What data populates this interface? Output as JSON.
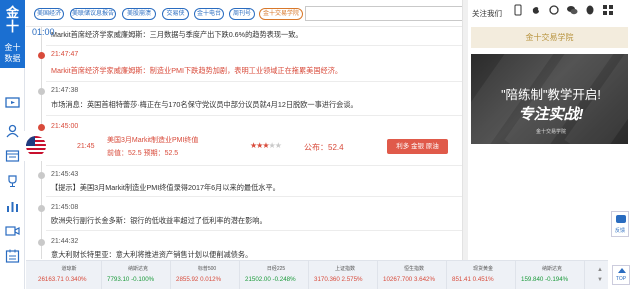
{
  "sidebar": {
    "logo_line1": "金十",
    "logo_line2": "金十",
    "logo_line3": "数据"
  },
  "tags": [
    {
      "label": "美国经济",
      "active": false
    },
    {
      "label": "美联储议息报告",
      "active": false
    },
    {
      "label": "美股崩溃",
      "active": false
    },
    {
      "label": "交易侠",
      "active": false
    },
    {
      "label": "金十电台",
      "active": false
    },
    {
      "label": "周刊号",
      "active": false
    },
    {
      "label": "金十交易学院",
      "active": true
    }
  ],
  "overlay_text": "01:00",
  "feed": [
    {
      "time": "",
      "text": "Markit首席经济学家威廉姆斯：三月数据与季度产出下跌0.6%的趋势表现一致。",
      "highlight": false
    },
    {
      "time": "21:47:47",
      "text": "Markit首席经济学家威廉姆斯：制造业PMI下跌趋势加剧，表明工业领域正在拖累美国经济。",
      "highlight": true
    },
    {
      "time": "21:47:38",
      "text": "市场消息：英国首相特蕾莎·梅正在与170名保守党议员中部分议员就4月12日脱欧一事进行会谈。",
      "highlight": false
    },
    {
      "time": "21:45:00",
      "text": "",
      "highlight": true
    },
    {
      "time": "21:45:43",
      "text": "【提示】美国3月Markit制造业PMI终值录得2017年6月以来的最低水平。",
      "highlight": false
    },
    {
      "time": "21:45:08",
      "text": "欧洲央行副行长金多斯：银行的低收益率超过了低利率的潜在影响。",
      "highlight": false
    },
    {
      "time": "21:44:32",
      "text": "意大利财长特里亚：意大利将推进资产销售计划以便削减债务。",
      "highlight": false
    }
  ],
  "card": {
    "time": "21:45",
    "title": "美国3月Markit制造业PMI终值",
    "prev": "前值：52.5   预期：52.5",
    "stars": 3,
    "stars_max": 5,
    "published": "公布：52.4",
    "impact": "利多 金银 原油"
  },
  "rightcol": {
    "follow_label": "关注我们",
    "academy": "金十交易学院",
    "ad_line1": "\"陪练制\"教学开启!",
    "ad_line2": "专注实战!",
    "ad_line3": "金十交易学院",
    "feedback": "反馈",
    "top": "TOP"
  },
  "icons": {
    "social": [
      "phone-icon",
      "weibo-icon",
      "link-icon",
      "wechat-icon",
      "qq-icon",
      "grid-icon"
    ],
    "sidebar": [
      "tv-icon",
      "user-icon",
      "calendar-icon",
      "trophy-icon",
      "chart-icon",
      "video-icon",
      "schedule-icon"
    ]
  },
  "ticker": [
    {
      "name": "道琼斯",
      "value": "26163.71",
      "change": "0.340%",
      "dir": "up"
    },
    {
      "name": "纳斯达克",
      "value": "7793.10",
      "change": "-0.100%",
      "dir": "down"
    },
    {
      "name": "标普500",
      "value": "2855.92",
      "change": "0.012%",
      "dir": "up"
    },
    {
      "name": "日经225",
      "value": "21502.00",
      "change": "-0.248%",
      "dir": "down"
    },
    {
      "name": "上证指数",
      "value": "3170.360",
      "change": "2.575%",
      "dir": "up"
    },
    {
      "name": "恒生指数",
      "value": "10267.700",
      "change": "3.642%",
      "dir": "up"
    },
    {
      "name": "现货黄金",
      "value": "851.41",
      "change": "0.451%",
      "dir": "up"
    },
    {
      "name": "纳斯达克",
      "value": "159.840",
      "change": "-0.194%",
      "dir": "down"
    }
  ],
  "colors": {
    "accent": "#2a6cc0",
    "highlight_red": "#d84a3a",
    "up": "#d84a3a",
    "down": "#1a9a3a",
    "academy_gold": "#b8943f"
  }
}
